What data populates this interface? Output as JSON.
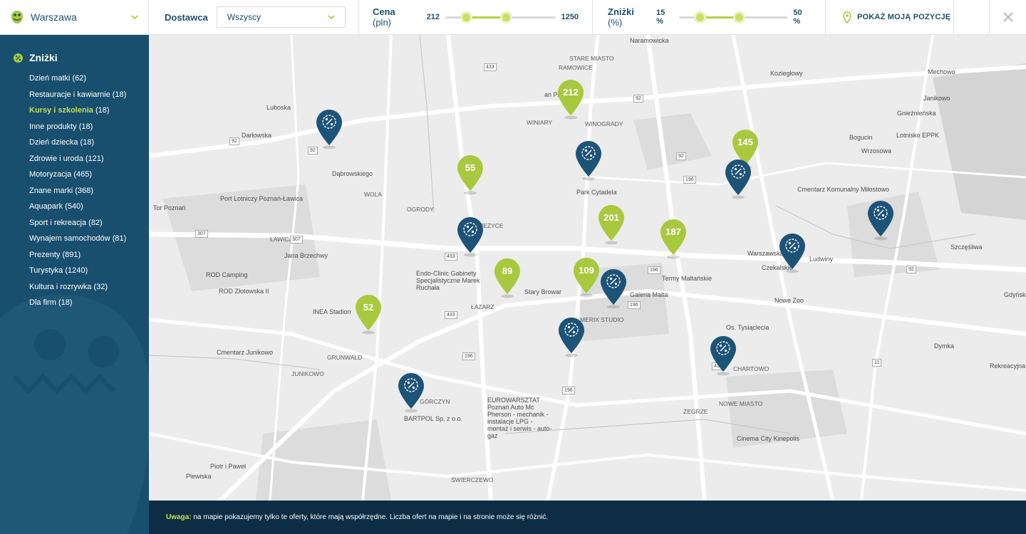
{
  "header": {
    "city": "Warszawa",
    "provider_label": "Dostawca",
    "provider_value": "Wszyscy",
    "price_label": "Cena",
    "price_unit": "(pln)",
    "price_min": "212",
    "price_max": "1250",
    "price_range_fraction": [
      0.19,
      0.55
    ],
    "discount_label": "Zniżki",
    "discount_unit": "(%)",
    "discount_min": "15 %",
    "discount_max": "50 %",
    "discount_range_fraction": [
      0.19,
      0.55
    ],
    "show_position_label": "POKAŻ MOJĄ POZYCJĘ"
  },
  "sidebar": {
    "title": "Zniżki",
    "items": [
      {
        "label": "Dzień matki",
        "count": "(62)"
      },
      {
        "label": "Restauracje i kawiarnie",
        "count": "(18)"
      },
      {
        "label": "Kursy i szkolenia",
        "count": "(18)",
        "active": true
      },
      {
        "label": "Inne produkty",
        "count": "(18)"
      },
      {
        "label": "Dzień dziecka",
        "count": "(18)"
      },
      {
        "label": "Zdrowie i uroda",
        "count": "(121)"
      },
      {
        "label": "Motoryzacja",
        "count": "(465)"
      },
      {
        "label": "Znane marki",
        "count": "(368)"
      },
      {
        "label": "Aquapark",
        "count": "(540)"
      },
      {
        "label": "Sport i rekreacja",
        "count": "(82)"
      },
      {
        "label": "Wynajem samochodów",
        "count": "(81)"
      },
      {
        "label": "Prezenty",
        "count": "(891)"
      },
      {
        "label": "Turystyka",
        "count": "(1240)"
      },
      {
        "label": "Kultura i rozrywka",
        "count": "(32)"
      },
      {
        "label": "Dla firm",
        "count": "(18)"
      }
    ]
  },
  "map": {
    "price_pins": [
      "212",
      "55",
      "145",
      "201",
      "187",
      "89",
      "109",
      "52"
    ],
    "labels": [
      "Naramowicka",
      "STARE MIASTO",
      "RAMOWICE",
      "Koziegłowy",
      "Mechowo",
      "Janikowo",
      "Gnieźnieńska",
      "Bogucin",
      "Lotnisko EPPK",
      "Wrzosowa",
      "Cmentarz Komunalny Miłostowo",
      "Park Cytadela",
      "WINIARY",
      "WINOGRADY",
      "an Plaza",
      "Luboska",
      "Darłowska",
      "Dąbrowskiego",
      "WOLA",
      "Port Lotniczy Poznań-Ławica",
      "Tor Poznań",
      "ŁAWICA",
      "JEŻYCE",
      "OGRODY",
      "Jana Brzechwy",
      "ROD Camping",
      "ROD Złotowska II",
      "Endo-Clinic Gabinety Specjalistyczne Marek Ruchała",
      "Stary Browar",
      "ŁAZARZ",
      "Galeria Malta",
      "Termy Maltańskie",
      "Nowe Zoo",
      "Os. Tysiąclecia",
      "INEA Stadion",
      "MERIX STUDIO",
      "Cmentarz Junikowo",
      "GRUNWALD",
      "JUNIKOWO",
      "CHARTOWO",
      "NOWE MIASTO",
      "ŻEGRZE",
      "EUROWARSZTAT Poznań Auto Mc Pherson - mechanik - instalacje LPG - montaż i serwis - auto-gaz",
      "BARTPOL Sp. z o.o.",
      "GÓRCZYN",
      "Cinema City Kinepolis",
      "Piotr i Paweł",
      "Plewiska",
      "ŚWIERCZEWO",
      "Warszawska",
      "Dymka",
      "Czekalskie",
      "Ludwiny",
      "Szczęśliwa",
      "Gdyńska",
      "Rekreacyjna"
    ],
    "road_numbers": [
      "433",
      "92",
      "92",
      "92",
      "92",
      "196",
      "196",
      "307",
      "307",
      "433",
      "433",
      "196",
      "196",
      "196",
      "433",
      "92",
      "11"
    ]
  },
  "footer": {
    "note_label": "Uwaga:",
    "note_text": "na mapie pokazujemy tylko te oferty, które mają współrzędne. Liczba ofert na mapie i na stronie może się różnić."
  },
  "colors": {
    "sidebar_bg": "#184f6f",
    "accent_green": "#a8c93e",
    "pin_blue": "#1d5377",
    "footer_bg": "#0c2d43",
    "text_blue": "#1d4f6e"
  }
}
